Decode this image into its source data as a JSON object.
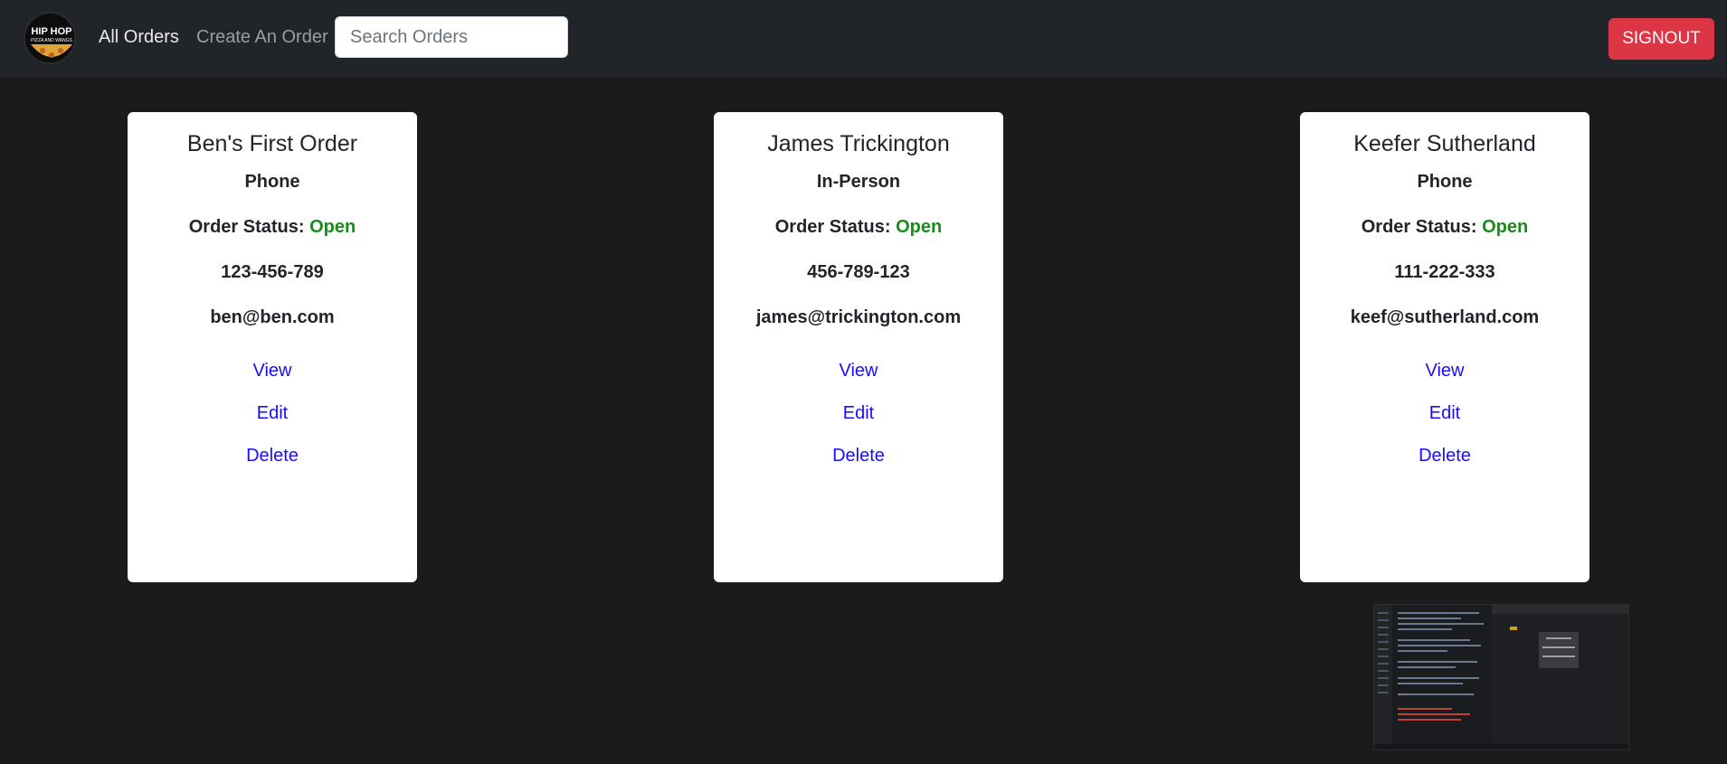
{
  "navbar": {
    "logo": {
      "icon": "hip-hop-pizza-logo",
      "line1": "HIP HOP",
      "line2": "PIZZA AND WANGS"
    },
    "links": [
      {
        "label": "All Orders",
        "active": true
      },
      {
        "label": "Create An Order",
        "active": false
      }
    ],
    "search": {
      "placeholder": "Search Orders",
      "value": ""
    },
    "signout_label": "SIGNOUT",
    "signout_color": "#dc3545"
  },
  "orders": [
    {
      "name": "Ben's First Order",
      "type": "Phone",
      "status_label": "Order Status:",
      "status": "Open",
      "phone": "123-456-789",
      "email": "ben@ben.com",
      "actions": {
        "view": "View",
        "edit": "Edit",
        "delete": "Delete"
      }
    },
    {
      "name": "James Trickington",
      "type": "In-Person",
      "status_label": "Order Status:",
      "status": "Open",
      "phone": "456-789-123",
      "email": "james@trickington.com",
      "actions": {
        "view": "View",
        "edit": "Edit",
        "delete": "Delete"
      }
    },
    {
      "name": "Keefer Sutherland",
      "type": "Phone",
      "status_label": "Order Status:",
      "status": "Open",
      "phone": "111-222-333",
      "email": "keef@sutherland.com",
      "actions": {
        "view": "View",
        "edit": "Edit",
        "delete": "Delete"
      }
    }
  ],
  "colors": {
    "page_background": "#1a1b1c",
    "navbar_background": "#212529",
    "status_open": "#198d19",
    "link": "#1a0dff"
  },
  "thumbnail": {
    "icon": "screen-preview-thumbnail"
  }
}
